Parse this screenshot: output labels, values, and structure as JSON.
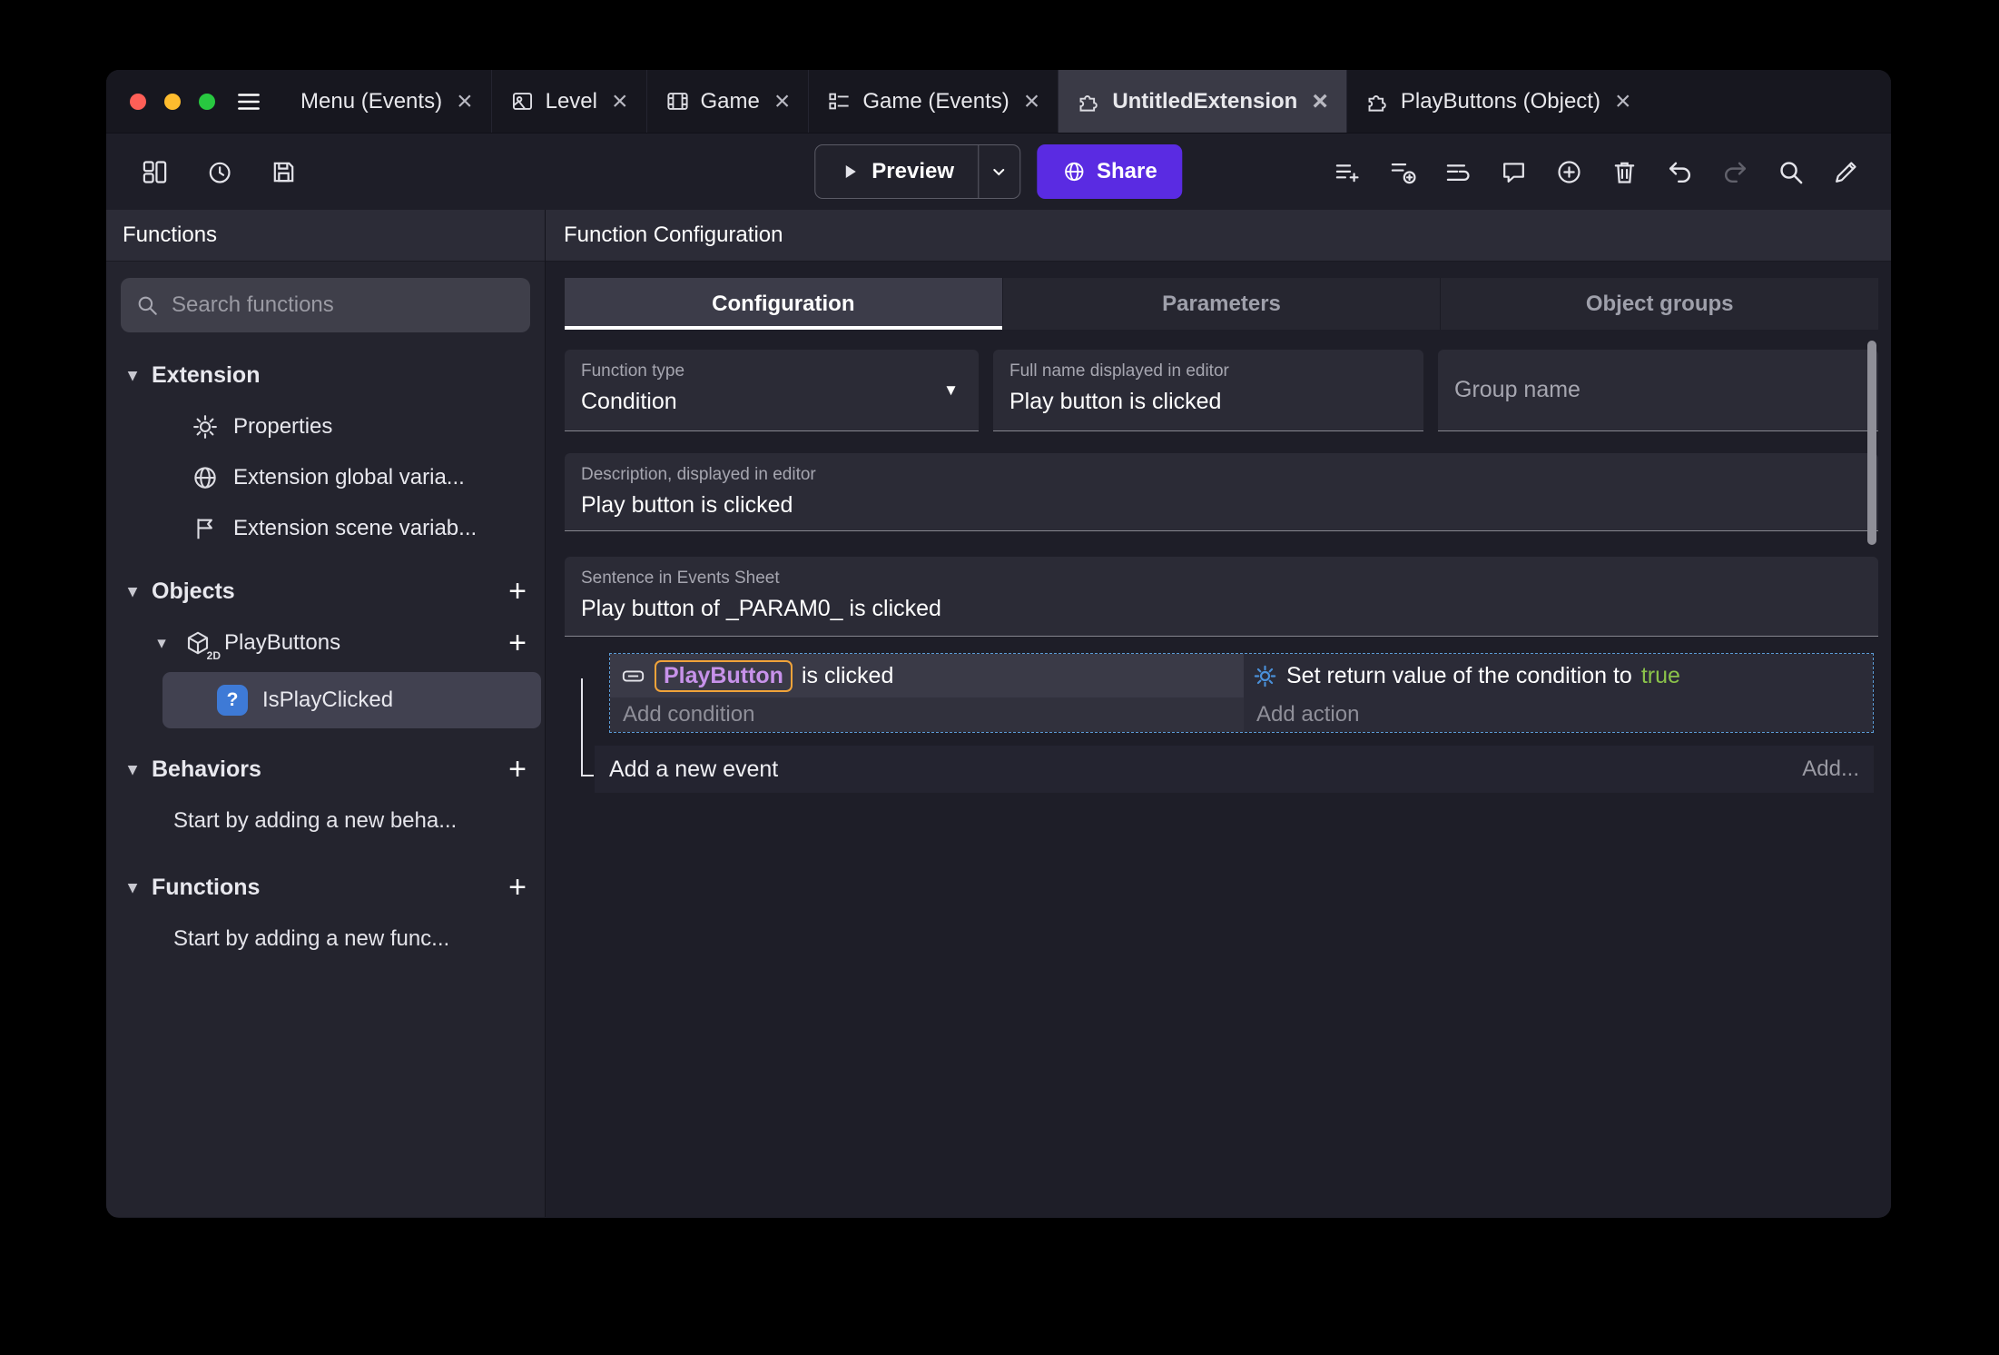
{
  "glyphs": {
    "close": "×",
    "plus": "+",
    "chevron_down": "▾",
    "dropdown": "▼",
    "question": "?",
    "cube_label": "2D"
  },
  "colors": {
    "accent_share": "#5a2be2",
    "traffic_red": "#ff5f57",
    "traffic_yellow": "#febc2e",
    "traffic_green": "#28c840",
    "object_chip_border": "#f0a33a",
    "object_chip_text": "#c792ea",
    "action_true": "#8bc34a",
    "selected_event_border": "#5b9bd5",
    "action_gear": "#4a90d9"
  },
  "titlebar": {
    "tabs": [
      {
        "label": "Menu (Events)"
      },
      {
        "label": "Level"
      },
      {
        "label": "Game"
      },
      {
        "label": "Game (Events)"
      },
      {
        "label": "UntitledExtension"
      },
      {
        "label": "PlayButtons (Object)"
      }
    ]
  },
  "toolbar": {
    "preview": "Preview",
    "share": "Share"
  },
  "sidebar": {
    "header": "Functions",
    "search_placeholder": "Search functions",
    "extension_section": "Extension",
    "extension_items": [
      "Properties",
      "Extension global varia...",
      "Extension scene variab..."
    ],
    "objects_section": "Objects",
    "playbuttons_label": "PlayButtons",
    "selected_function": "IsPlayClicked",
    "behaviors_section": "Behaviors",
    "behaviors_empty": "Start by adding a new beha...",
    "functions_section": "Functions",
    "functions_empty": "Start by adding a new func..."
  },
  "main": {
    "header": "Function Configuration",
    "tabs": [
      "Configuration",
      "Parameters",
      "Object groups"
    ],
    "fields": {
      "function_type_label": "Function type",
      "function_type_value": "Condition",
      "full_name_label": "Full name displayed in editor",
      "full_name_value": "Play button is clicked",
      "group_name_placeholder": "Group name",
      "description_label": "Description, displayed in editor",
      "description_value": "Play button is clicked",
      "sentence_label": "Sentence in Events Sheet",
      "sentence_value": "Play button of _PARAM0_ is clicked"
    },
    "events": {
      "condition_object": "PlayButton",
      "condition_rest": "is clicked",
      "add_condition": "Add condition",
      "action_prefix": "Set return value of the condition to",
      "action_value": "true",
      "add_action": "Add action",
      "add_new_event": "Add a new event",
      "add_button": "Add..."
    }
  }
}
